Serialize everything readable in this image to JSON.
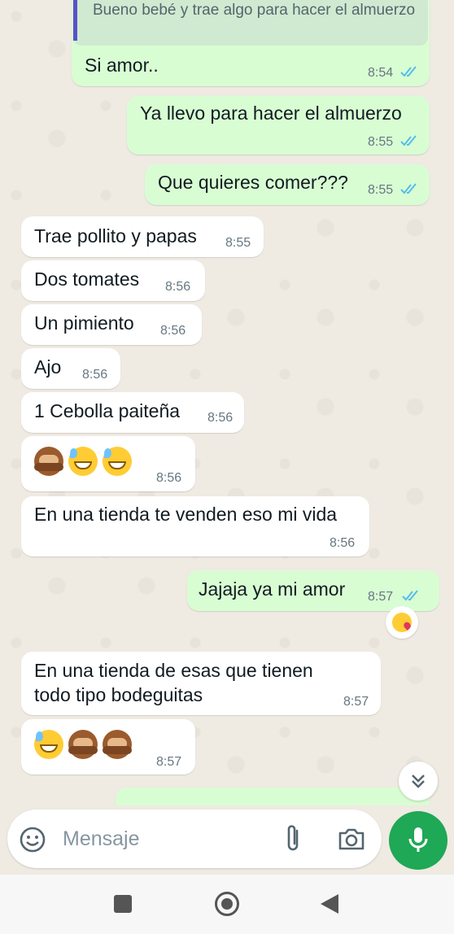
{
  "quoted": {
    "text": "Bueno bebé y trae algo para hacer el almuerzo"
  },
  "messages": [
    {
      "dir": "out",
      "text": "Si amor..",
      "time": "8:54"
    },
    {
      "dir": "out",
      "text": "Ya llevo para hacer el almuerzo",
      "time": "8:55"
    },
    {
      "dir": "out",
      "text": "Que quieres comer???",
      "time": "8:55"
    },
    {
      "dir": "in",
      "text": "Trae pollito y papas",
      "time": "8:55"
    },
    {
      "dir": "in",
      "text": "Dos tomates",
      "time": "8:56"
    },
    {
      "dir": "in",
      "text": "Un pimiento",
      "time": "8:56"
    },
    {
      "dir": "in",
      "text": "Ajo",
      "time": "8:56"
    },
    {
      "dir": "in",
      "text": "1 Cebolla paiteña",
      "time": "8:56"
    },
    {
      "dir": "in",
      "emojis": [
        "see-no-evil-monkey",
        "grinning-sweat",
        "grinning-sweat"
      ],
      "time": "8:56"
    },
    {
      "dir": "in",
      "text": "En una tienda te venden eso mi vida",
      "time": "8:56"
    },
    {
      "dir": "out",
      "text": "Jajaja ya mi amor",
      "time": "8:57",
      "reaction": "face-blowing-kiss"
    },
    {
      "dir": "in",
      "line1": "En una tienda de esas que tienen",
      "line2": "todo tipo bodeguitas",
      "time": "8:57"
    },
    {
      "dir": "in",
      "emojis": [
        "grinning-sweat",
        "see-no-evil-monkey",
        "see-no-evil-monkey"
      ],
      "time": "8:57"
    }
  ],
  "composer": {
    "placeholder": "Mensaje"
  },
  "icons": {
    "emoji": "smiley-icon",
    "attach": "paperclip-icon",
    "camera": "camera-icon",
    "mic": "microphone-icon",
    "scroll": "double-chevron-down-icon"
  },
  "colors": {
    "chat_bg": "#efeae2",
    "outgoing_bubble": "#d9fdd3",
    "incoming_bubble": "#ffffff",
    "read_ticks": "#53bdeb",
    "accent": "#1fa855"
  }
}
